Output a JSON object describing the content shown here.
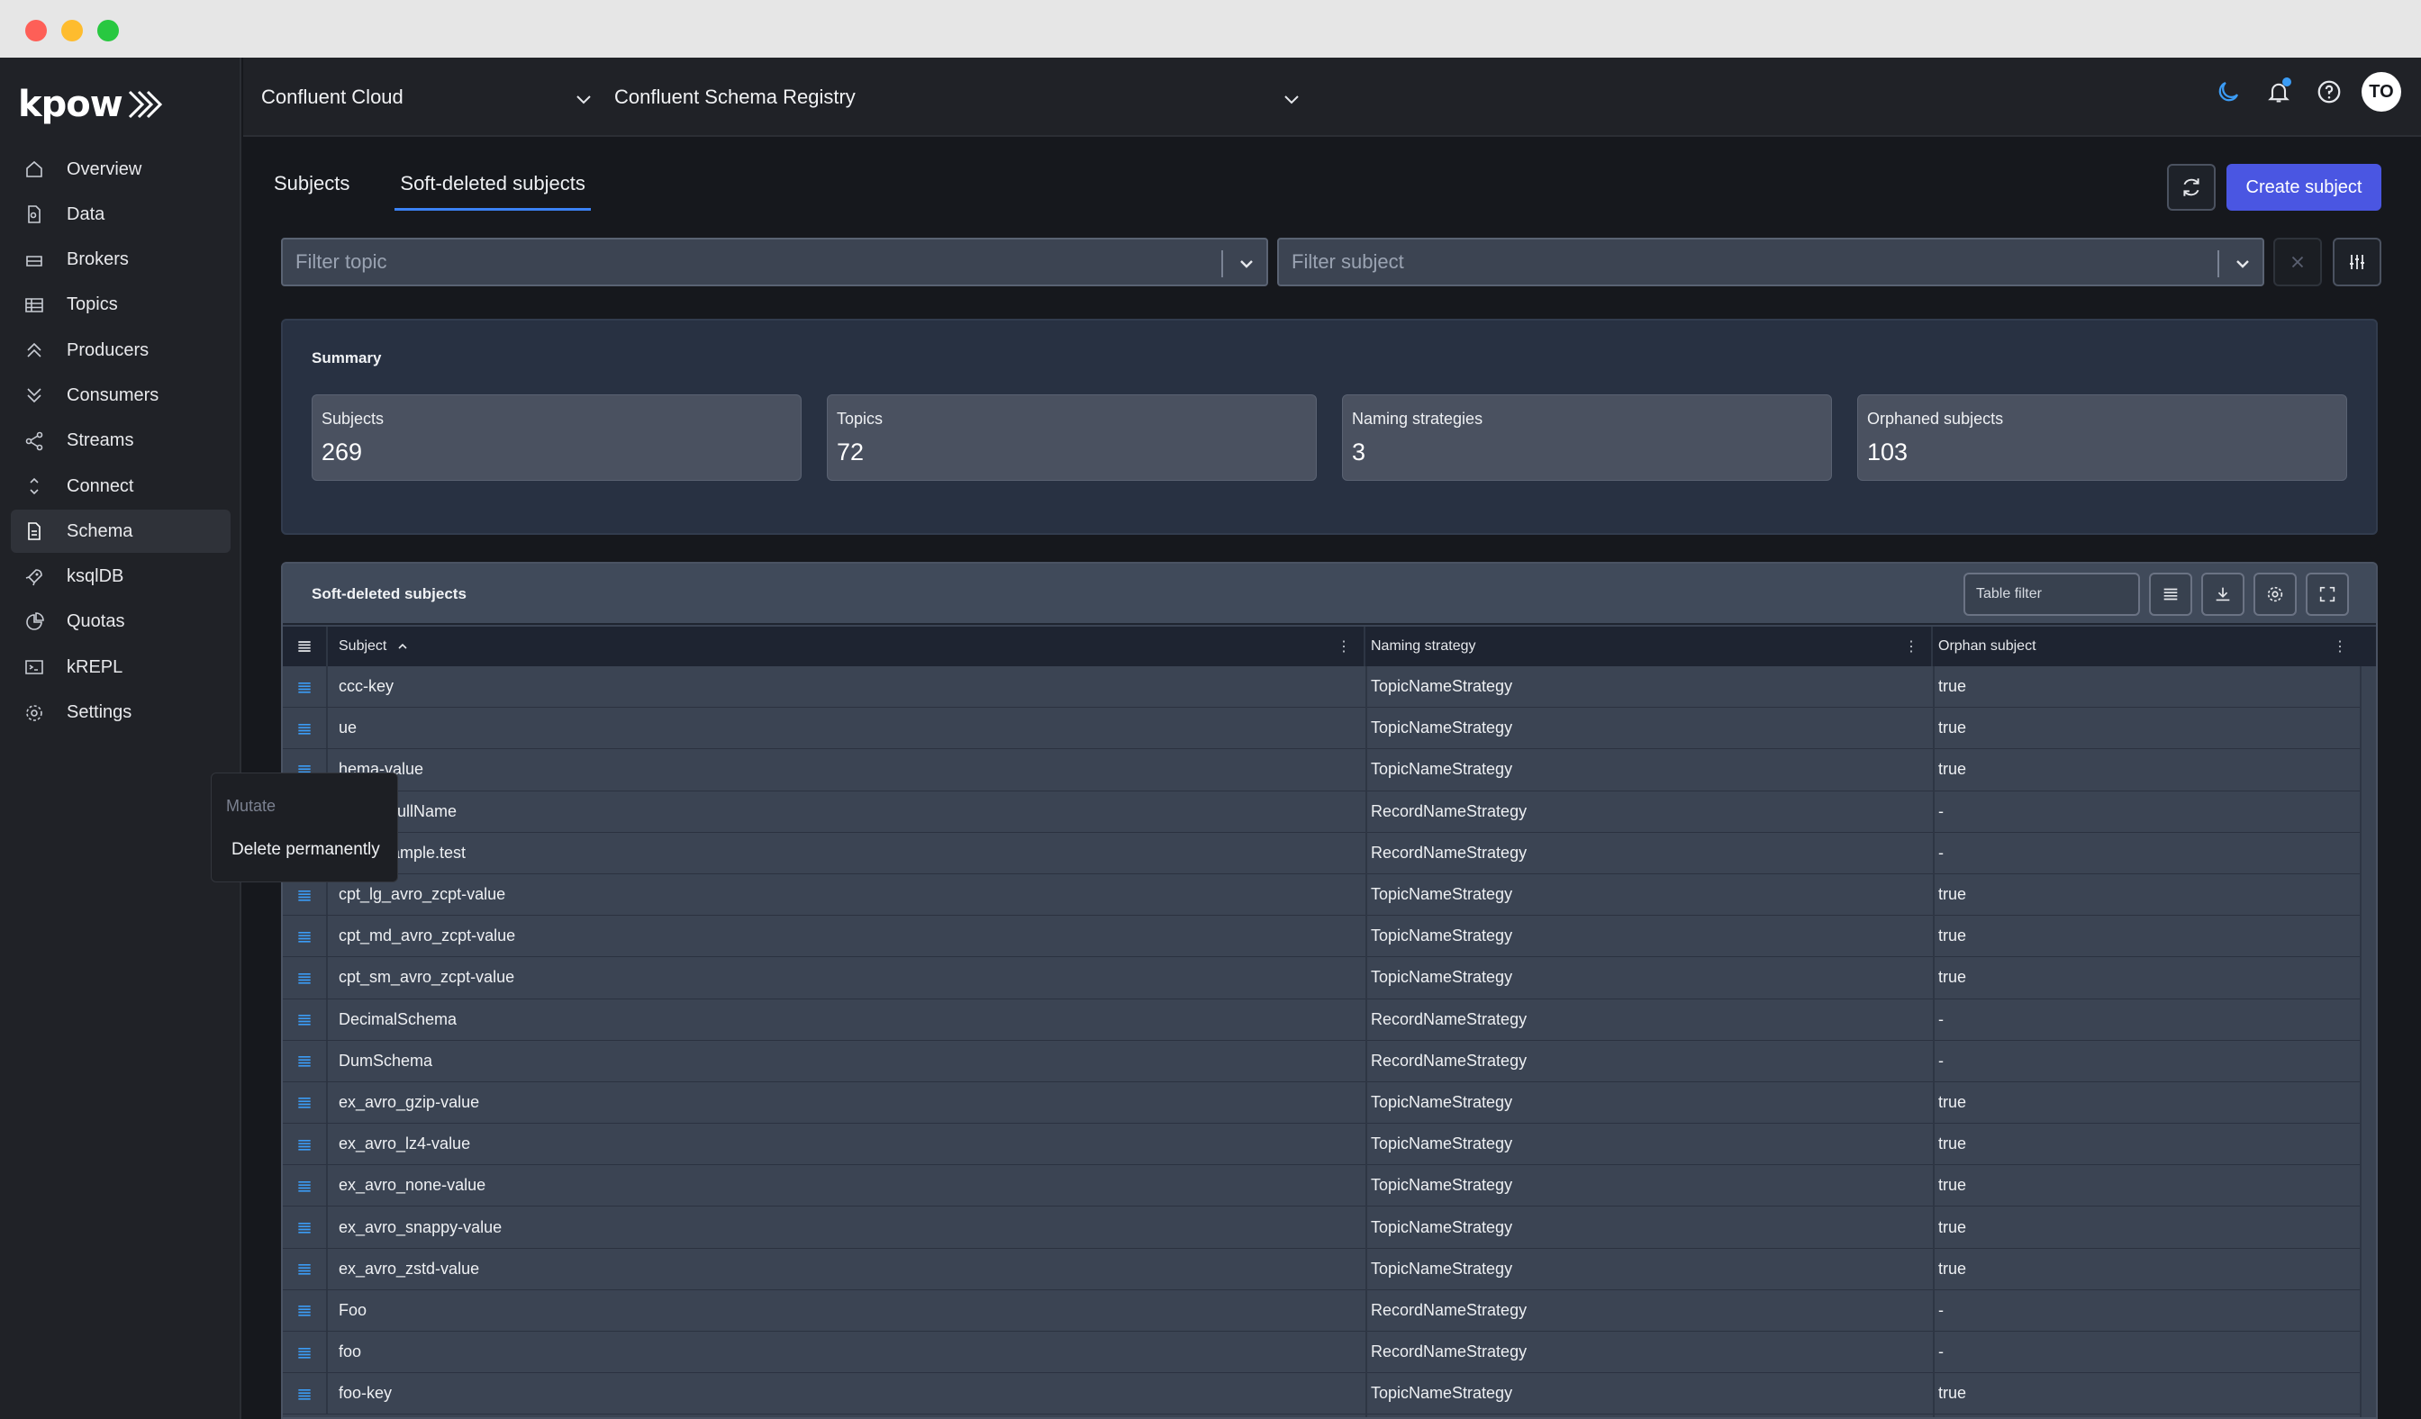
{
  "app": {
    "logo": "kpow"
  },
  "sidebar": {
    "items": [
      {
        "label": "Overview",
        "icon": "home-icon"
      },
      {
        "label": "Data",
        "icon": "file-search-icon"
      },
      {
        "label": "Brokers",
        "icon": "server-icon"
      },
      {
        "label": "Topics",
        "icon": "table-icon"
      },
      {
        "label": "Producers",
        "icon": "chevrons-up-icon"
      },
      {
        "label": "Consumers",
        "icon": "chevrons-down-icon"
      },
      {
        "label": "Streams",
        "icon": "share-icon"
      },
      {
        "label": "Connect",
        "icon": "connect-icon"
      },
      {
        "label": "Schema",
        "icon": "document-icon",
        "active": true
      },
      {
        "label": "ksqlDB",
        "icon": "rocket-icon"
      },
      {
        "label": "Quotas",
        "icon": "pie-chart-icon"
      },
      {
        "label": "kREPL",
        "icon": "terminal-icon"
      },
      {
        "label": "Settings",
        "icon": "gear-icon"
      }
    ]
  },
  "topbar": {
    "environment": "Confluent Cloud",
    "registry": "Confluent Schema Registry",
    "avatar_initials": "TO"
  },
  "tabs": [
    {
      "label": "Subjects",
      "active": false
    },
    {
      "label": "Soft-deleted subjects",
      "active": true
    }
  ],
  "actions": {
    "create_label": "Create subject"
  },
  "filters": {
    "topic_placeholder": "Filter topic",
    "subject_placeholder": "Filter subject"
  },
  "summary": {
    "title": "Summary",
    "cards": [
      {
        "label": "Subjects",
        "value": "269"
      },
      {
        "label": "Topics",
        "value": "72"
      },
      {
        "label": "Naming strategies",
        "value": "3"
      },
      {
        "label": "Orphaned subjects",
        "value": "103"
      }
    ]
  },
  "table": {
    "title": "Soft-deleted subjects",
    "filter_placeholder": "Table filter",
    "columns": [
      "Subject",
      "Naming strategy",
      "Orphan subject"
    ],
    "rows": [
      {
        "subject": "ccc-key",
        "strategy": "TopicNameStrategy",
        "orphan": "true"
      },
      {
        "subject": "ue",
        "strategy": "TopicNameStrategy",
        "orphan": "true"
      },
      {
        "subject": "hema-value",
        "strategy": "TopicNameStrategy",
        "orphan": "true"
      },
      {
        "subject": "ample.FullName",
        "strategy": "RecordNameStrategy",
        "orphan": "-"
      },
      {
        "subject": "com.example.test",
        "strategy": "RecordNameStrategy",
        "orphan": "-"
      },
      {
        "subject": "cpt_lg_avro_zcpt-value",
        "strategy": "TopicNameStrategy",
        "orphan": "true"
      },
      {
        "subject": "cpt_md_avro_zcpt-value",
        "strategy": "TopicNameStrategy",
        "orphan": "true"
      },
      {
        "subject": "cpt_sm_avro_zcpt-value",
        "strategy": "TopicNameStrategy",
        "orphan": "true"
      },
      {
        "subject": "DecimalSchema",
        "strategy": "RecordNameStrategy",
        "orphan": "-"
      },
      {
        "subject": "DumSchema",
        "strategy": "RecordNameStrategy",
        "orphan": "-"
      },
      {
        "subject": "ex_avro_gzip-value",
        "strategy": "TopicNameStrategy",
        "orphan": "true"
      },
      {
        "subject": "ex_avro_lz4-value",
        "strategy": "TopicNameStrategy",
        "orphan": "true"
      },
      {
        "subject": "ex_avro_none-value",
        "strategy": "TopicNameStrategy",
        "orphan": "true"
      },
      {
        "subject": "ex_avro_snappy-value",
        "strategy": "TopicNameStrategy",
        "orphan": "true"
      },
      {
        "subject": "ex_avro_zstd-value",
        "strategy": "TopicNameStrategy",
        "orphan": "true"
      },
      {
        "subject": "Foo",
        "strategy": "RecordNameStrategy",
        "orphan": "-"
      },
      {
        "subject": "foo",
        "strategy": "RecordNameStrategy",
        "orphan": "-"
      },
      {
        "subject": "foo-key",
        "strategy": "TopicNameStrategy",
        "orphan": "true"
      }
    ]
  },
  "context_menu": {
    "header": "Mutate",
    "item": "Delete permanently"
  },
  "colors": {
    "accent": "#4a56e2",
    "tab_underline": "#3b82f6",
    "handle_icon": "#3b9cf5"
  }
}
